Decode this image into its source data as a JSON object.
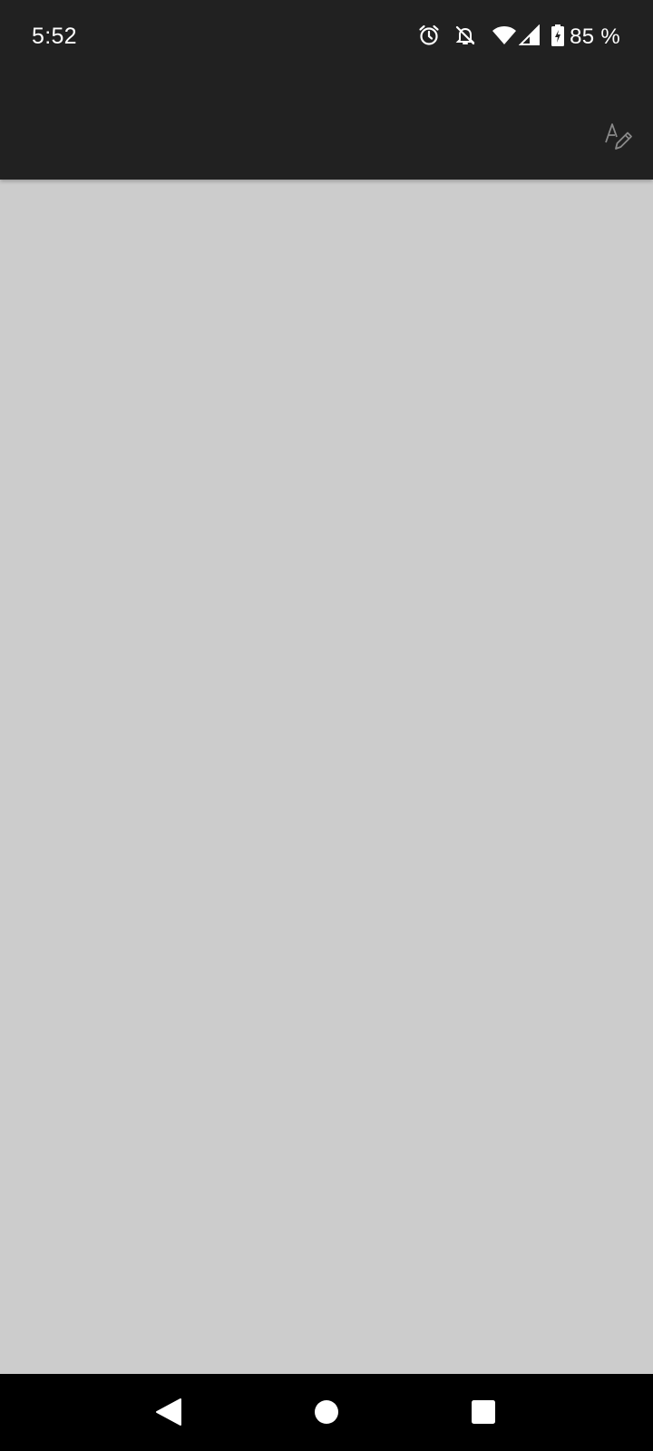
{
  "status_bar": {
    "time": "5:52",
    "battery": "85 %",
    "icons": [
      "alarm-icon",
      "notifications-off-icon",
      "wifi-icon",
      "cellular-signal-icon",
      "battery-charging-icon"
    ]
  },
  "toolbar": {
    "action_icon": "text-edit-icon"
  },
  "navigation": {
    "icons": [
      "back-icon",
      "home-icon",
      "recents-icon"
    ]
  },
  "colors": {
    "header": "#212121",
    "content": "#cccccc",
    "nav_bar": "#000000"
  }
}
